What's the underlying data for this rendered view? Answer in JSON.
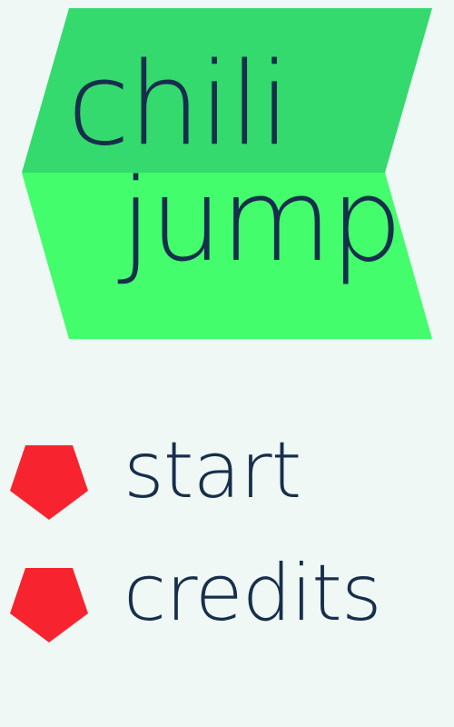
{
  "game": {
    "title_line_1": "chili",
    "title_line_2": "jump"
  },
  "menu": {
    "items": [
      {
        "label": "start",
        "icon": "pentagon-icon"
      },
      {
        "label": "credits",
        "icon": "pentagon-icon"
      }
    ]
  },
  "colors": {
    "background": "#EFF8F5",
    "banner_top": "#34DA6E",
    "banner_bottom": "#43FD6C",
    "text": "#172E4C",
    "bullet": "#F7242F"
  }
}
